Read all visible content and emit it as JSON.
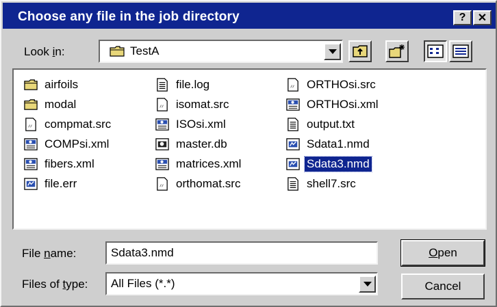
{
  "window": {
    "title": "Choose any file in the job directory",
    "help_label": "?",
    "close_label": "✕"
  },
  "look_in": {
    "label_pre": "Look ",
    "label_accel": "i",
    "label_post": "n:",
    "value": "TestA"
  },
  "files": [
    {
      "name": "airfoils",
      "icon": "folder-icon",
      "selected": false
    },
    {
      "name": "modal",
      "icon": "folder-icon",
      "selected": false
    },
    {
      "name": "compmat.src",
      "icon": "src-file-icon",
      "selected": false
    },
    {
      "name": "COMPsi.xml",
      "icon": "xml-file-icon",
      "selected": false
    },
    {
      "name": "fibers.xml",
      "icon": "xml-file-icon",
      "selected": false
    },
    {
      "name": "file.err",
      "icon": "data-file-icon",
      "selected": false
    },
    {
      "name": "file.log",
      "icon": "text-file-icon",
      "selected": false
    },
    {
      "name": "isomat.src",
      "icon": "src-file-icon",
      "selected": false
    },
    {
      "name": "ISOsi.xml",
      "icon": "xml-file-icon",
      "selected": false
    },
    {
      "name": "master.db",
      "icon": "db-file-icon",
      "selected": false
    },
    {
      "name": "matrices.xml",
      "icon": "xml-file-icon",
      "selected": false
    },
    {
      "name": "orthomat.src",
      "icon": "src-file-icon",
      "selected": false
    },
    {
      "name": "ORTHOsi.src",
      "icon": "src-file-icon",
      "selected": false
    },
    {
      "name": "ORTHOsi.xml",
      "icon": "xml-file-icon",
      "selected": false
    },
    {
      "name": "output.txt",
      "icon": "text-file-icon",
      "selected": false
    },
    {
      "name": "Sdata1.nmd",
      "icon": "data-file-icon",
      "selected": false
    },
    {
      "name": "Sdata3.nmd",
      "icon": "data-file-icon",
      "selected": true
    },
    {
      "name": "shell7.src",
      "icon": "text-file-icon",
      "selected": false
    }
  ],
  "file_name": {
    "label_pre": "File ",
    "label_accel": "n",
    "label_post": "ame:",
    "value": "Sdata3.nmd"
  },
  "file_type": {
    "label_pre": "Files of ",
    "label_accel": "t",
    "label_post": "ype:",
    "value": "All Files (*.*)"
  },
  "buttons": {
    "open_accel": "O",
    "open_rest": "pen",
    "cancel": "Cancel"
  },
  "colors": {
    "titlebar": "#0f2590",
    "selection": "#0f2590",
    "face": "#cfcfcf"
  }
}
